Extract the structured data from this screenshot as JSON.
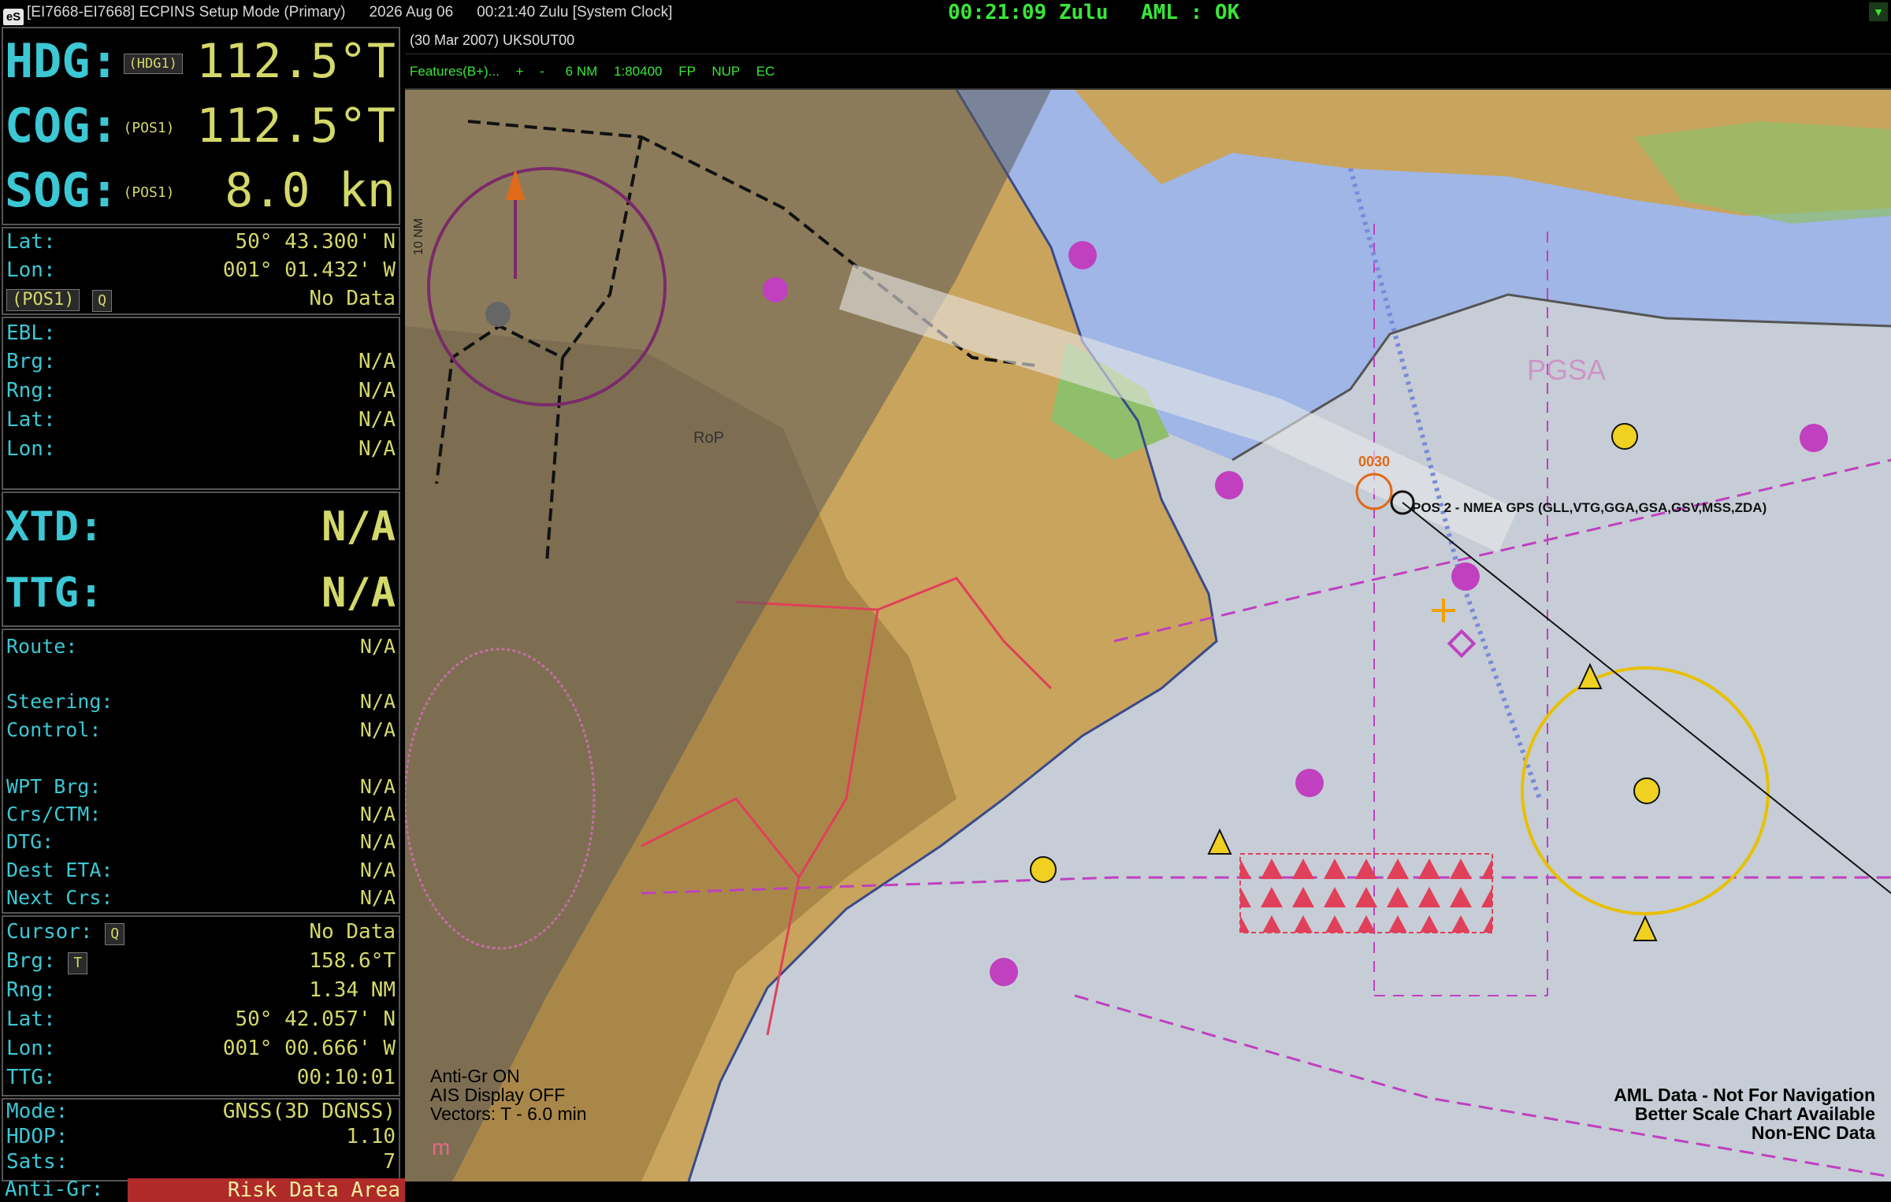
{
  "title_bar": {
    "app": "[EI7668-EI7668] ECPINS  Setup Mode (Primary)",
    "date": "2026 Aug 06",
    "time": "00:21:40 Zulu  [System Clock]"
  },
  "status_bar": {
    "clock": "00:21:09 Zulu",
    "aml": "AML : OK"
  },
  "nav": {
    "hdg": {
      "label": "HDG:",
      "source": "(HDG1)",
      "value": "112.5°T"
    },
    "cog": {
      "label": "COG:",
      "source": "(POS1)",
      "value": "112.5°T"
    },
    "sog": {
      "label": "SOG:",
      "source": "(POS1)",
      "value": "8.0 kn"
    }
  },
  "position": {
    "lat_label": "Lat:",
    "lat": "50° 43.300' N",
    "lon_label": "Lon:",
    "lon": "001° 01.432' W",
    "source": "(POS1)",
    "q": "Q",
    "quality": "No Data"
  },
  "ebl": {
    "title": "EBL:",
    "brg_label": "Brg:",
    "brg": "N/A",
    "rng_label": "Rng:",
    "rng": "N/A",
    "lat_label": "Lat:",
    "lat": "N/A",
    "lon_label": "Lon:",
    "lon": "N/A"
  },
  "xtd": {
    "label": "XTD:",
    "value": "N/A"
  },
  "ttg": {
    "label": "TTG:",
    "value": "N/A"
  },
  "route": {
    "route_label": "Route:",
    "route": "N/A",
    "steering_label": "Steering:",
    "steering": "N/A",
    "control_label": "Control:",
    "control": "N/A",
    "wpt_brg_label": "WPT Brg:",
    "wpt_brg": "N/A",
    "crs_label": "Crs/CTM:",
    "crs": "N/A",
    "dtg_label": "DTG:",
    "dtg": "N/A",
    "eta_label": "Dest ETA:",
    "eta": "N/A",
    "next_label": "Next Crs:",
    "next": "N/A"
  },
  "cursor": {
    "title": "Cursor:",
    "q": "Q",
    "quality": "No Data",
    "brg_label": "Brg:",
    "t": "T",
    "brg": "158.6°T",
    "rng_label": "Rng:",
    "rng": "1.34 NM",
    "lat_label": "Lat:",
    "lat": "50° 42.057' N",
    "lon_label": "Lon:",
    "lon": "001° 00.666' W",
    "ttg_label": "TTG:",
    "ttg": "00:10:01"
  },
  "gnss": {
    "mode_label": "Mode:",
    "mode": "GNSS(3D DGNSS)",
    "hdop_label": "HDOP:",
    "hdop": "1.10",
    "sats_label": "Sats:",
    "sats": "7",
    "antigr_label": "Anti-Gr:",
    "antigr": "Risk Data Area"
  },
  "chart": {
    "header": "(30 Mar 2007) UKS0UT00",
    "toolbar": [
      "Features(B+)...",
      "+",
      "-",
      "6 NM",
      "1:80400",
      "FP",
      "NUP",
      "EC"
    ],
    "overlay_left": [
      "Anti-Gr ON",
      "AIS Display OFF",
      "Vectors: T - 6.0 min"
    ],
    "overlay_right": [
      "AML Data - Not For Navigation",
      "Better Scale Chart Available",
      "Non-ENC Data"
    ],
    "ais_label": "POS 2 - NMEA GPS  (GLL,VTG,GGA,GSA,GSV,MSS,ZDA)",
    "depth_label": "0030",
    "place_label": "RoP",
    "area_label": "PGSA",
    "scale_label": "10 NM",
    "m_label": "m"
  },
  "colors": {
    "land": "#c9a45c",
    "land_dark": "#8a6a35",
    "shallow": "#9fb6e6",
    "deep": "#c6cdd6",
    "green": "#8fbf6a",
    "shade": "#5a5a5a",
    "magenta": "#c040c0",
    "accent_text": "#d4d86a",
    "label_text": "#3cc7d4",
    "status_green": "#39e639"
  }
}
